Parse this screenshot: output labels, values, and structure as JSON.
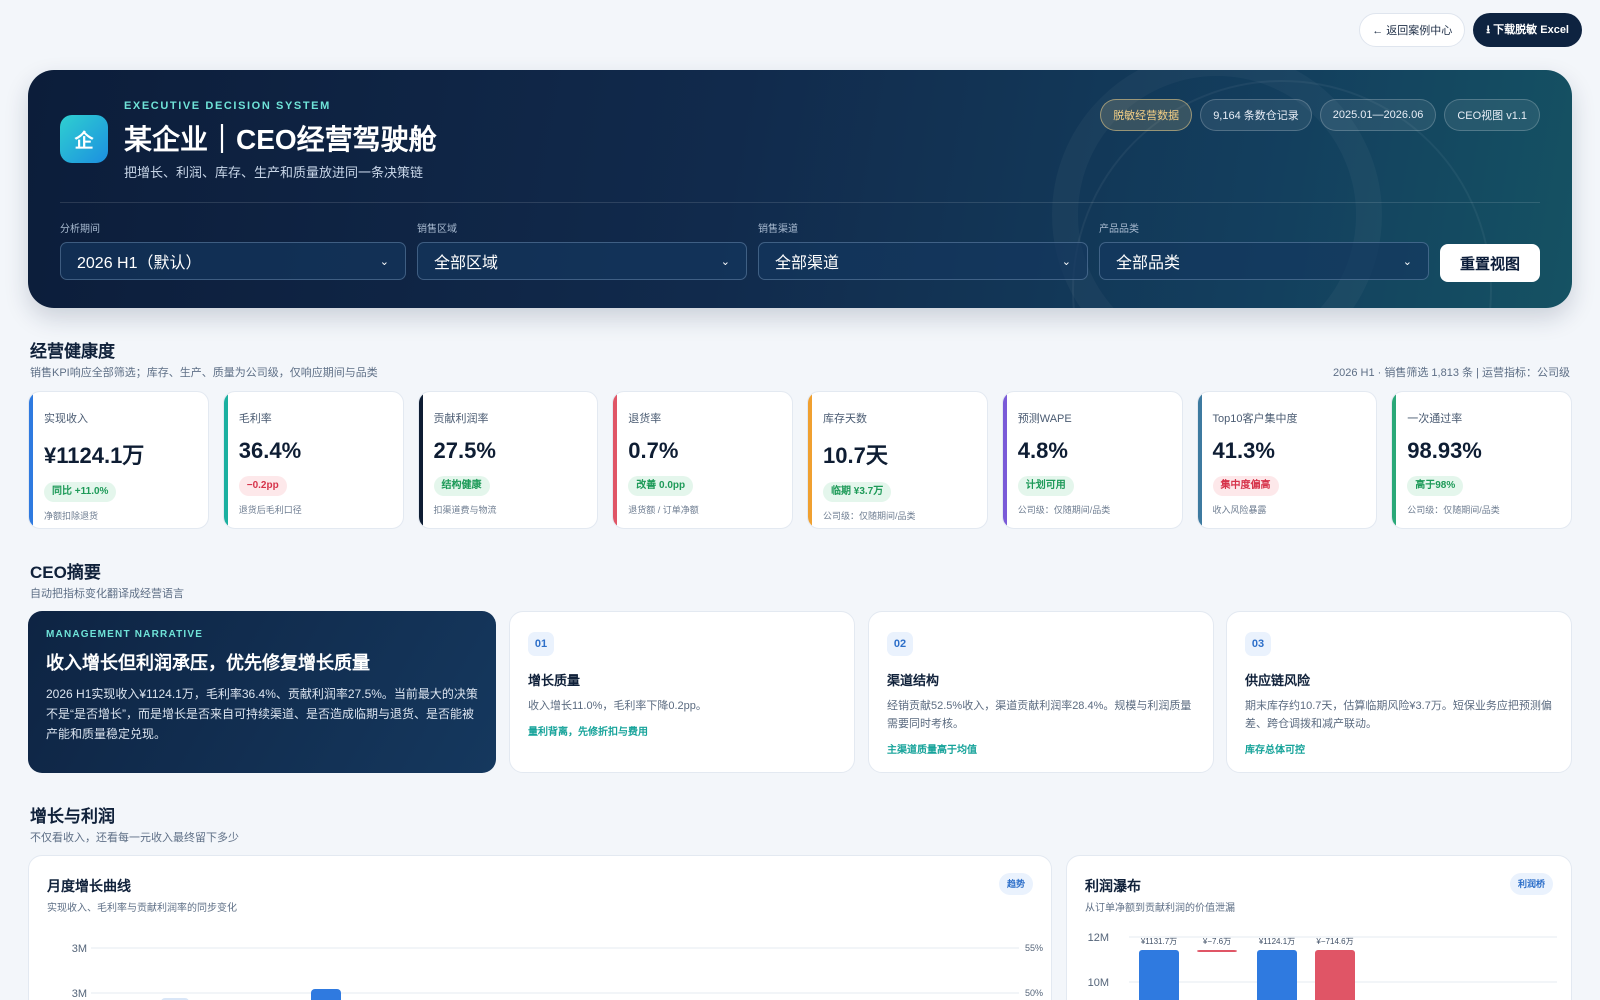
{
  "topbar": {
    "back_label": "← 返回案例中心",
    "download_label": "⭳ 下载脱敏 Excel"
  },
  "hero": {
    "logo_text": "企",
    "eyebrow": "EXECUTIVE DECISION SYSTEM",
    "title": "某企业｜CEO经营驾驶舱",
    "subtitle": "把增长、利润、库存、生产和质量放进同一条决策链",
    "tags": [
      "脱敏经营数据",
      "9,164 条数仓记录",
      "2025.01—2026.06",
      "CEO视图 v1.1"
    ],
    "filters": [
      {
        "label": "分析期间",
        "value": "2026 H1（默认）"
      },
      {
        "label": "销售区域",
        "value": "全部区域"
      },
      {
        "label": "销售渠道",
        "value": "全部渠道"
      },
      {
        "label": "产品品类",
        "value": "全部品类"
      }
    ],
    "reset_label": "重置视图"
  },
  "health": {
    "title": "经营健康度",
    "subtitle": "销售KPI响应全部筛选；库存、生产、质量为公司级，仅响应期间与品类",
    "meta": "2026 H1 · 销售筛选 1,813 条 | 运营指标：公司级",
    "kpis": [
      {
        "label": "实现收入",
        "value": "¥1124.1万",
        "badge": "同比 +11.0%",
        "badge_type": "green",
        "note": "净额扣除退货",
        "color": "#2f7ae0"
      },
      {
        "label": "毛利率",
        "value": "36.4%",
        "badge": "−0.2pp",
        "badge_type": "red",
        "note": "退货后毛利口径",
        "color": "#1bb0a0"
      },
      {
        "label": "贡献利润率",
        "value": "27.5%",
        "badge": "结构健康",
        "badge_type": "green",
        "note": "扣渠道费与物流",
        "color": "#0e1d33"
      },
      {
        "label": "退货率",
        "value": "0.7%",
        "badge": "改善 0.0pp",
        "badge_type": "green",
        "note": "退货额 / 订单净额",
        "color": "#e05566"
      },
      {
        "label": "库存天数",
        "value": "10.7天",
        "badge": "临期 ¥3.7万",
        "badge_type": "green",
        "note": "公司级：仅随期间/品类",
        "color": "#f0a030"
      },
      {
        "label": "预测WAPE",
        "value": "4.8%",
        "badge": "计划可用",
        "badge_type": "green",
        "note": "公司级：仅随期间/品类",
        "color": "#7a5ad8"
      },
      {
        "label": "Top10客户集中度",
        "value": "41.3%",
        "badge": "集中度偏高",
        "badge_type": "red",
        "note": "收入风险暴露",
        "color": "#3d7aa0"
      },
      {
        "label": "一次通过率",
        "value": "98.93%",
        "badge": "高于98%",
        "badge_type": "green",
        "note": "公司级：仅随期间/品类",
        "color": "#2aa878"
      }
    ]
  },
  "summary": {
    "title": "CEO摘要",
    "subtitle": "自动把指标变化翻译成经营语言",
    "narrative": {
      "eyebrow": "MANAGEMENT NARRATIVE",
      "title": "收入增长但利润承压，优先修复增长质量",
      "body": "2026 H1实现收入¥1124.1万，毛利率36.4%、贡献利润率27.5%。当前最大的决策不是“是否增长”，而是增长是否来自可持续渠道、是否造成临期与退货、是否能被产能和质量稳定兑现。"
    },
    "insights": [
      {
        "num": "01",
        "title": "增长质量",
        "body": "收入增长11.0%，毛利率下降0.2pp。",
        "foot": "量利背离，先修折扣与费用"
      },
      {
        "num": "02",
        "title": "渠道结构",
        "body": "经销贡献52.5%收入，渠道贡献利润率28.4%。规模与利润质量需要同时考核。",
        "foot": "主渠道质量高于均值"
      },
      {
        "num": "03",
        "title": "供应链风险",
        "body": "期末库存约10.7天，估算临期风险¥3.7万。短保业务应把预测偏差、跨仓调拨和减产联动。",
        "foot": "库存总体可控"
      }
    ]
  },
  "growth": {
    "title": "增长与利润",
    "subtitle": "不仅看收入，还看每一元收入最终留下多少",
    "trend_card": {
      "title": "月度增长曲线",
      "subtitle": "实现收入、毛利率与贡献利润率的同步变化",
      "tag": "趋势"
    },
    "waterfall_card": {
      "title": "利润瀑布",
      "subtitle": "从订单净额到贡献利润的价值泄漏",
      "tag": "利润桥"
    }
  },
  "chart_data": [
    {
      "type": "line",
      "title": "月度增长曲线",
      "y_ticks_left": [
        "3M",
        "3M"
      ],
      "y_ticks_right": [
        "55%",
        "50%"
      ]
    },
    {
      "type": "bar",
      "title": "利润瀑布",
      "y_ticks": [
        "12M",
        "10M"
      ],
      "ylim": [
        0,
        12
      ],
      "bars": [
        {
          "label": "¥1131.7万",
          "value": 1131.7,
          "kind": "positive"
        },
        {
          "label": "¥−7.6万",
          "value": -7.6,
          "kind": "negative"
        },
        {
          "label": "¥1124.1万",
          "value": 1124.1,
          "kind": "positive"
        },
        {
          "label": "¥−714.6万",
          "value": -714.6,
          "kind": "negative"
        }
      ]
    }
  ],
  "colors": {
    "accent_blue": "#2f7ae0",
    "accent_red": "#e05566",
    "teal": "#6fe3d8"
  }
}
